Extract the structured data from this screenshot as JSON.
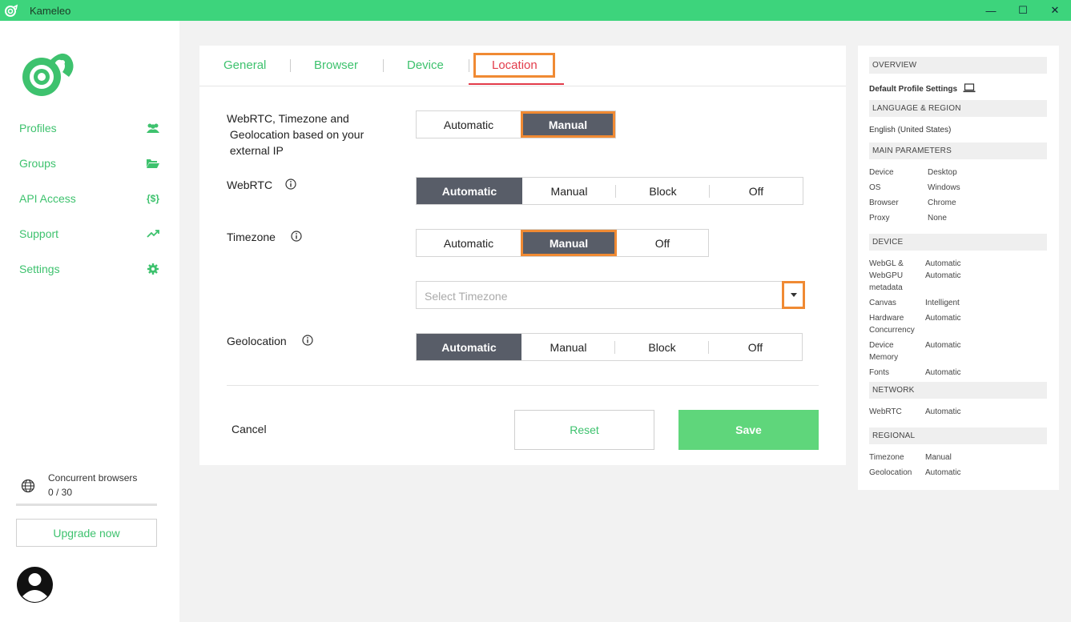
{
  "titlebar": {
    "title": "Kameleo",
    "minimize": "—",
    "maximize": "☐",
    "close": "✕"
  },
  "sidebar": {
    "items": [
      {
        "label": "Profiles",
        "icon": "users-icon"
      },
      {
        "label": "Groups",
        "icon": "folder-open-icon"
      },
      {
        "label": "API Access",
        "icon": "code-braces-icon"
      },
      {
        "label": "Support",
        "icon": "trend-up-icon"
      },
      {
        "label": "Settings",
        "icon": "gear-icon"
      }
    ],
    "api_icon_text": "{$}",
    "concurrent_title": "Concurrent browsers",
    "concurrent_count": "0 / 30",
    "concurrent_fraction": 0.0,
    "upgrade_label": "Upgrade now"
  },
  "tabs": {
    "general": "General",
    "browser": "Browser",
    "device": "Device",
    "location": "Location",
    "active": "Location"
  },
  "form": {
    "webrtc_tz_geo_label": "WebRTC, Timezone and Geolocation based on your external IP",
    "webrtc_tz_geo_line1": "WebRTC, Timezone and",
    "webrtc_tz_geo_line2": " Geolocation based on your",
    "webrtc_tz_geo_line3": " external IP",
    "mode": {
      "options": [
        "Automatic",
        "Manual"
      ],
      "selected": "Manual"
    },
    "webrtc_label": "WebRTC",
    "webrtc": {
      "options": [
        "Automatic",
        "Manual",
        "Block",
        "Off"
      ],
      "selected": "Automatic"
    },
    "timezone_label": "Timezone",
    "timezone": {
      "options": [
        "Automatic",
        "Manual",
        "Off"
      ],
      "selected": "Manual"
    },
    "timezone_placeholder": "Select Timezone",
    "geolocation_label": "Geolocation",
    "geolocation": {
      "options": [
        "Automatic",
        "Manual",
        "Block",
        "Off"
      ],
      "selected": "Automatic"
    },
    "cancel": "Cancel",
    "reset": "Reset",
    "save": "Save"
  },
  "overview": {
    "overview_head": "OVERVIEW",
    "default_profile": "Default Profile Settings",
    "lang_head": "LANGUAGE & REGION",
    "language": "English (United States)",
    "main_head": "MAIN PARAMETERS",
    "main": [
      {
        "k": "Device",
        "v": "Desktop"
      },
      {
        "k": "OS",
        "v": "Windows"
      },
      {
        "k": "Browser",
        "v": "Chrome"
      },
      {
        "k": "Proxy",
        "v": "None"
      }
    ],
    "device_head": "DEVICE",
    "device": {
      "webgl_k1": "WebGL &",
      "webgl_k2": "WebGPU",
      "webgl_k3": "metadata",
      "webgl_v1": "Automatic",
      "webgl_v2": "Automatic",
      "canvas_k": "Canvas",
      "canvas_v": "Intelligent",
      "hw_k1": "Hardware",
      "hw_k2": "Concurrency",
      "hw_v": "Automatic",
      "mem_k1": "Device",
      "mem_k2": "Memory",
      "mem_v": "Automatic",
      "fonts_k": "Fonts",
      "fonts_v": "Automatic"
    },
    "network_head": "NETWORK",
    "network": [
      {
        "k": "WebRTC",
        "v": "Automatic"
      }
    ],
    "regional_head": "REGIONAL",
    "regional": [
      {
        "k": "Timezone",
        "v": "Manual"
      },
      {
        "k": "Geolocation",
        "v": "Automatic"
      }
    ]
  },
  "colors": {
    "accent_green": "#3ec26e",
    "titlebar_green": "#3dd47c",
    "selected_dark": "#585d68",
    "active_tab_red": "#e23b4a",
    "highlight_orange": "#f08a33"
  }
}
